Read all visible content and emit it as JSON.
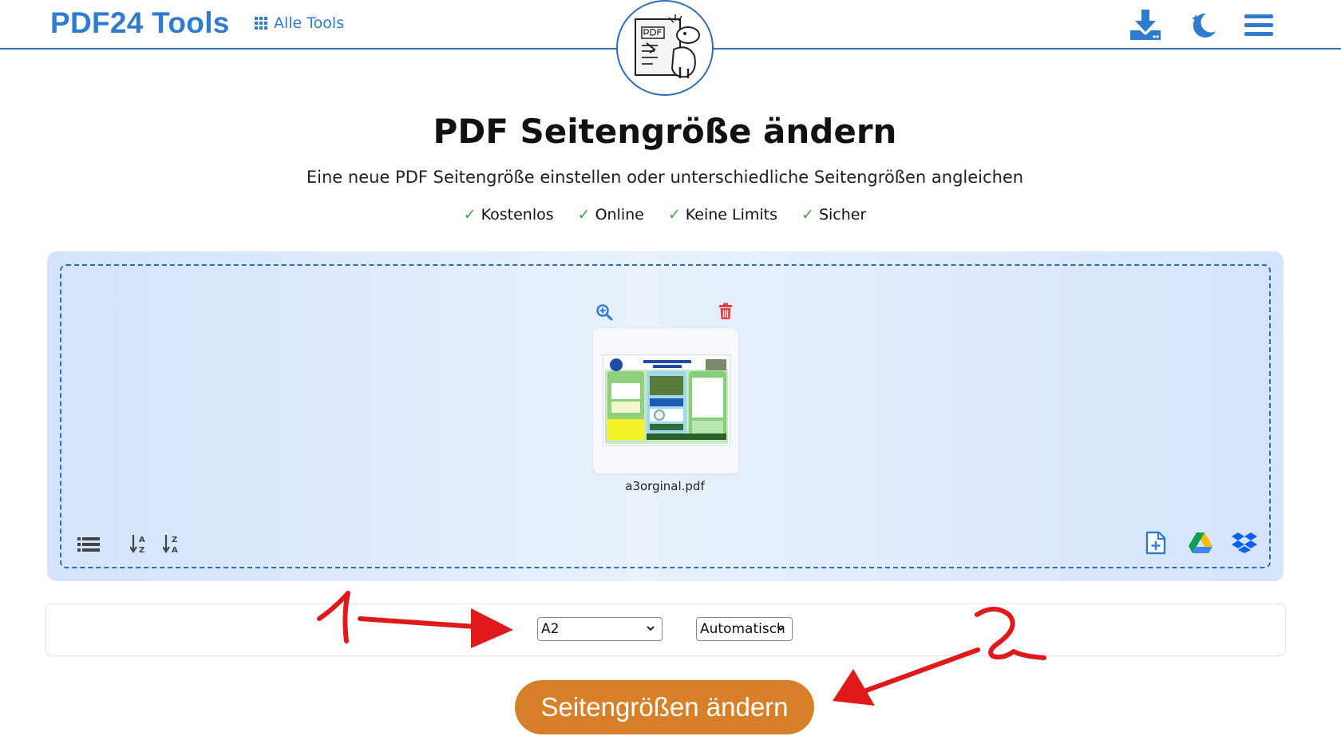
{
  "header": {
    "logo": "PDF24 Tools",
    "all_tools": "Alle Tools",
    "icons": [
      "download-icon",
      "dark-mode-icon",
      "menu-icon"
    ]
  },
  "main": {
    "title": "PDF Seitengröße ändern",
    "subtitle": "Eine neue PDF Seitengröße einstellen oder unterschiedliche Seitengrößen angleichen",
    "features": [
      "Kostenlos",
      "Online",
      "Keine Limits",
      "Sicher"
    ]
  },
  "dropzone": {
    "file_name": "a3orginal.pdf",
    "left_tools": [
      "list-view-icon",
      "sort-a-z-icon",
      "sort-z-a-icon"
    ],
    "right_tools": [
      "add-file-icon",
      "google-drive-icon",
      "dropbox-icon"
    ]
  },
  "options": {
    "page_size": "A2",
    "orientation": "Automatisch"
  },
  "submit_label": "Seitengrößen ändern",
  "annotations": [
    "1",
    "2"
  ],
  "colors": {
    "brand_blue": "#2f7bd0",
    "button_orange": "#d87f2a",
    "annotation_red": "#e0191b",
    "check_green": "#3aa83a"
  }
}
